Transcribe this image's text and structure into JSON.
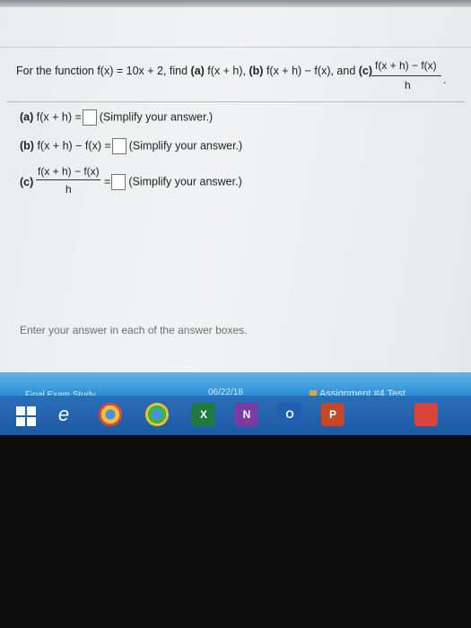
{
  "question": {
    "prefix": "For the function f(x) = 10x + 2, find ",
    "a_tag": "(a)",
    "a_text": " f(x + h), ",
    "b_tag": "(b)",
    "b_text": " f(x + h) − f(x), and ",
    "c_tag": "(c)",
    "frac_num": "f(x + h) − f(x)",
    "frac_den": "h",
    "end": "."
  },
  "parts": {
    "a_label": "(a)",
    "a_expr": " f(x + h) =",
    "b_label": "(b)",
    "b_expr": " f(x + h) − f(x) =",
    "c_label": "(c)",
    "c_num": "f(x + h) − f(x)",
    "c_den": "h",
    "c_eq": "=",
    "simplify": "(Simplify your answer.)"
  },
  "hint": "Enter your answer in each of the answer boxes.",
  "taskbar_strip": {
    "left": "Final Exam Study",
    "date": "06/22/18",
    "assignment": "Assignment #4 Test"
  },
  "taskbar": {
    "icons": [
      "windows-icon",
      "edge-icon",
      "chrome-icon",
      "chrome-alt-icon",
      "excel-icon",
      "onenote-icon",
      "outlook-icon",
      "powerpoint-icon",
      "app-icon"
    ],
    "excel_letter": "X",
    "onenote_letter": "N",
    "outlook_letter": "O",
    "ppt_letter": "P"
  }
}
